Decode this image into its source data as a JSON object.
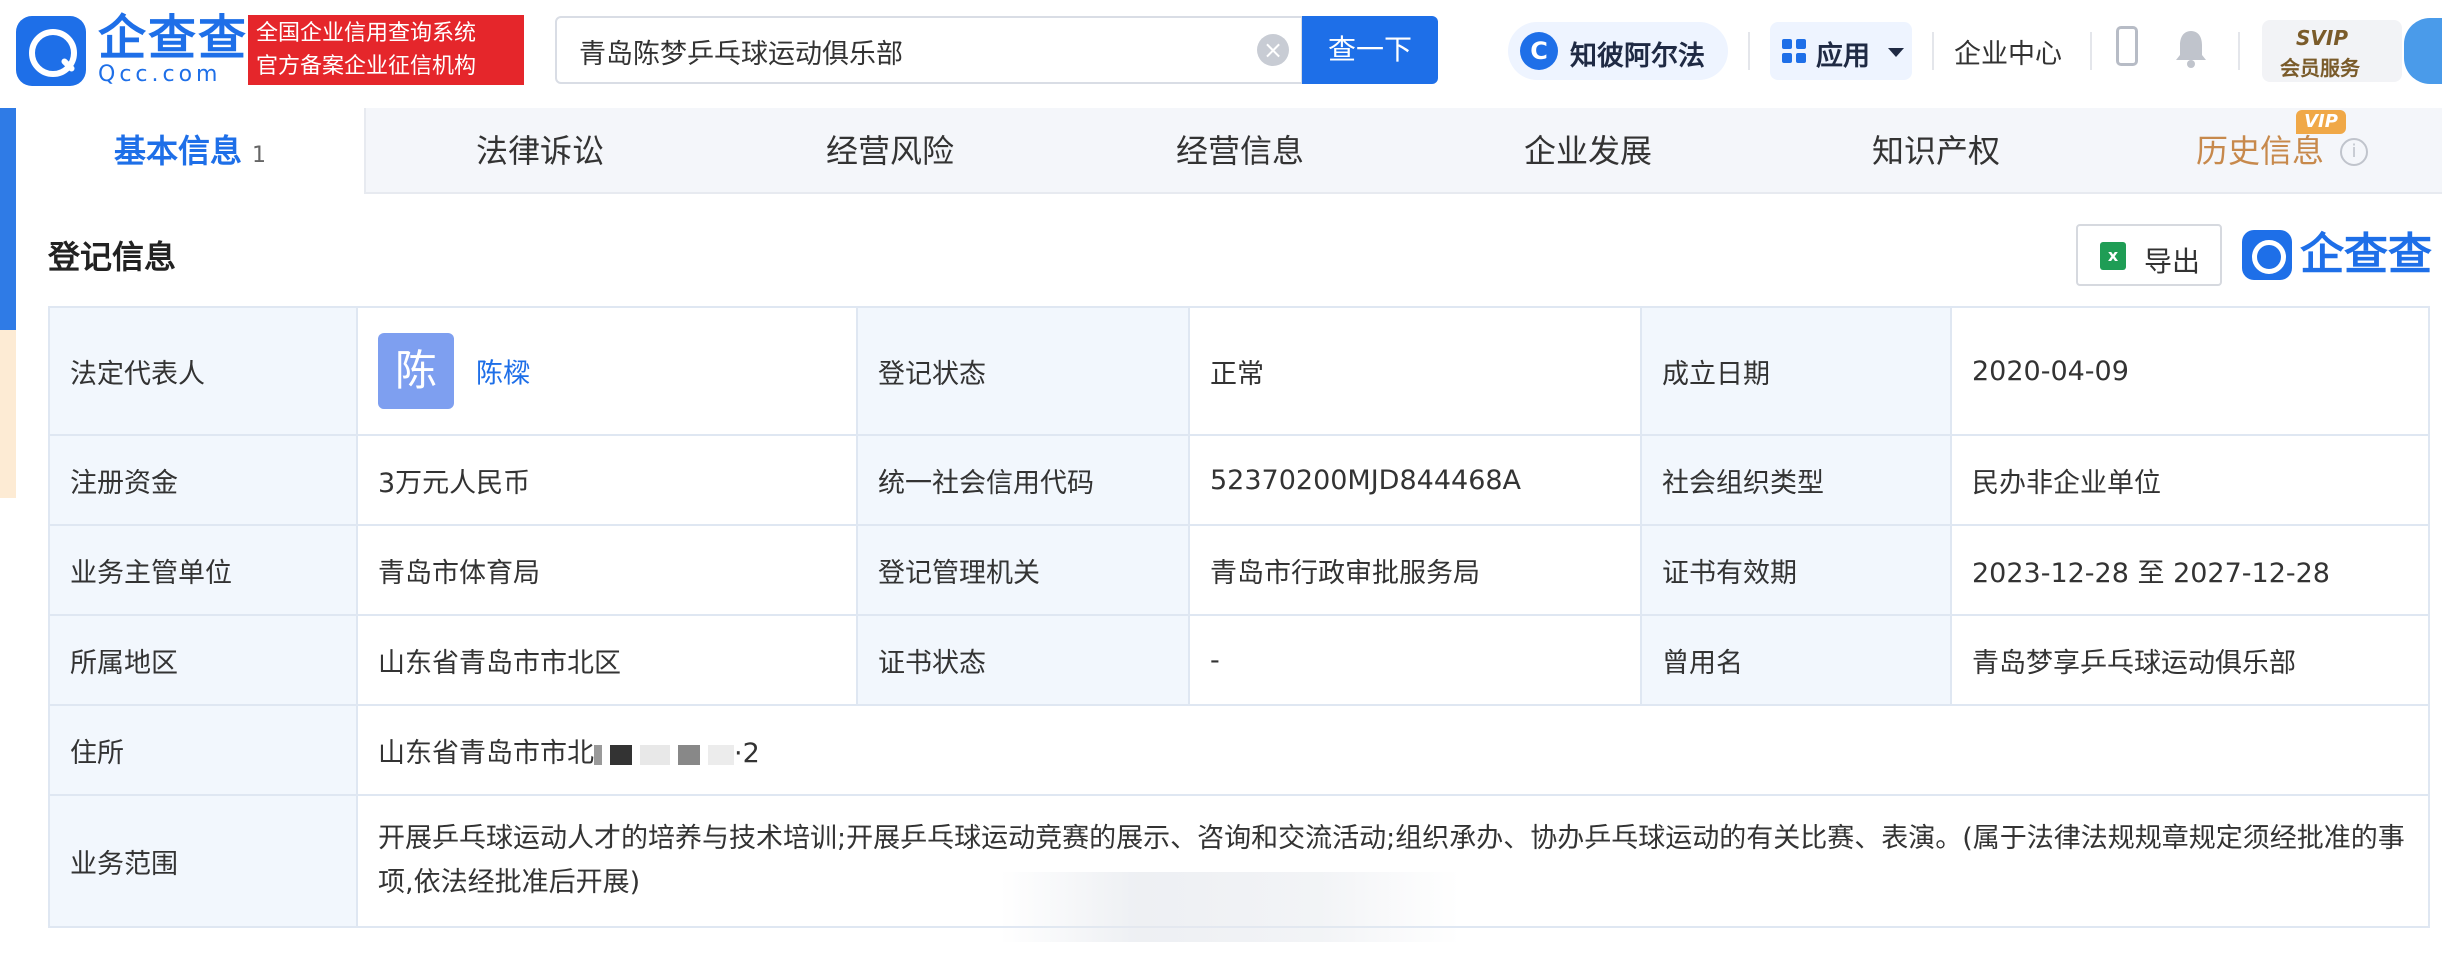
{
  "header": {
    "logo_text": "企查查",
    "logo_sub": "Qcc.com",
    "badge_line1": "全国企业信用查询系统",
    "badge_line2": "官方备案企业征信机构",
    "search_value": "青岛陈梦乒乓球运动俱乐部",
    "search_button": "查一下",
    "zhibi_label": "知彼阿尔法",
    "apps_label": "应用",
    "corp_center": "企业中心",
    "svip_line1": "SVIP",
    "svip_line2": "会员服务"
  },
  "tabs": [
    {
      "label": "基本信息",
      "count": "1"
    },
    {
      "label": "法律诉讼"
    },
    {
      "label": "经营风险"
    },
    {
      "label": "经营信息"
    },
    {
      "label": "企业发展"
    },
    {
      "label": "知识产权"
    },
    {
      "label": "历史信息",
      "tag": "VIP"
    }
  ],
  "section": {
    "title": "登记信息",
    "export_label": "导出",
    "brand": "企查查"
  },
  "registration": {
    "legal_rep_label": "法定代表人",
    "legal_rep_avatar": "陈",
    "legal_rep_name": "陈樑",
    "reg_status_label": "登记状态",
    "reg_status": "正常",
    "founded_label": "成立日期",
    "founded": "2020-04-09",
    "capital_label": "注册资金",
    "capital": "3万元人民币",
    "credit_code_label": "统一社会信用代码",
    "credit_code": "52370200MJD844468A",
    "org_type_label": "社会组织类型",
    "org_type": "民办非企业单位",
    "supervisor_label": "业务主管单位",
    "supervisor": "青岛市体育局",
    "registrar_label": "登记管理机关",
    "registrar": "青岛市行政审批服务局",
    "validity_label": "证书有效期",
    "validity": "2023-12-28 至 2027-12-28",
    "region_label": "所属地区",
    "region": "山东省青岛市市北区",
    "cert_status_label": "证书状态",
    "cert_status": "-",
    "former_name_label": "曾用名",
    "former_name": "青岛梦享乒乓球运动俱乐部",
    "address_label": "住所",
    "address_visible": "山东省青岛市市北",
    "address_tail": "·2",
    "scope_label": "业务范围",
    "scope": "开展乒乓球运动人才的培养与技术培训;开展乒乓球运动竞赛的展示、咨询和交流活动;组织承办、协办乒乓球运动的有关比赛、表演。(属于法律法规规章规定须经批准的事项,依法经批准后开展)"
  }
}
